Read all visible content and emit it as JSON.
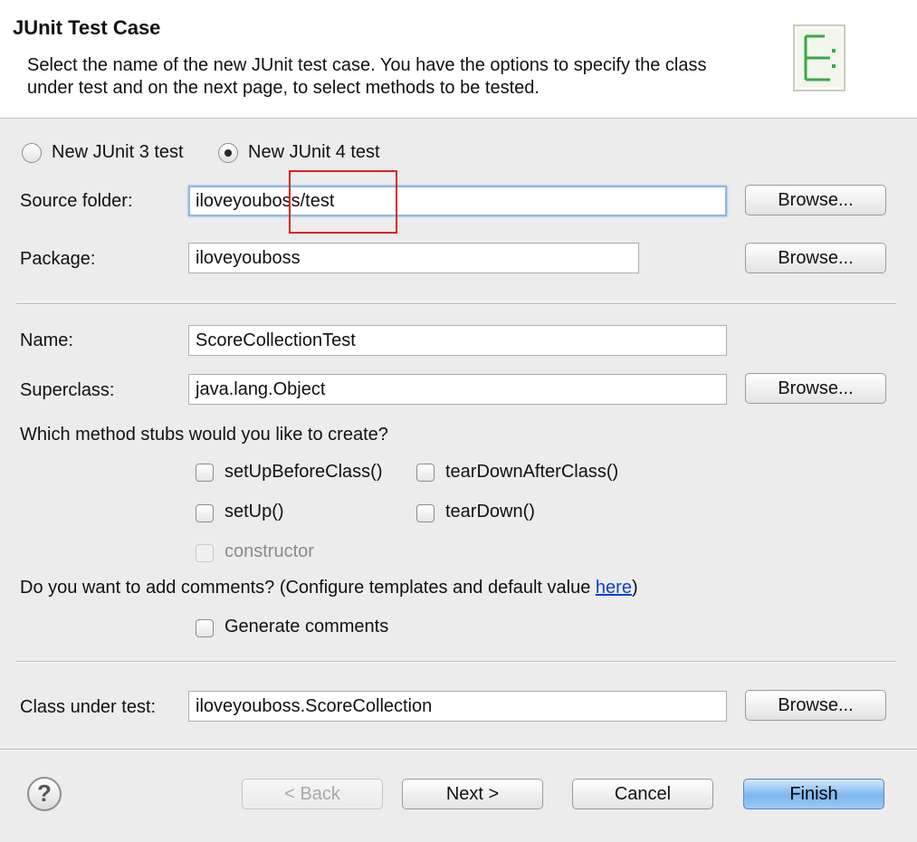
{
  "header": {
    "title": "JUnit Test Case",
    "description": "Select the name of the new JUnit test case. You have the options to specify the class under test and on the next page, to select methods to be tested."
  },
  "version": {
    "junit3_label": "New JUnit 3 test",
    "junit4_label": "New JUnit 4 test",
    "selected": "junit4"
  },
  "source_folder": {
    "label": "Source folder:",
    "value": "iloveyouboss/test"
  },
  "package": {
    "label": "Package:",
    "value": "iloveyouboss"
  },
  "name": {
    "label": "Name:",
    "value": "ScoreCollectionTest"
  },
  "superclass": {
    "label": "Superclass:",
    "value": "java.lang.Object"
  },
  "browse_label": "Browse...",
  "stubs": {
    "question": "Which method stubs would you like to create?",
    "setup_before_class": "setUpBeforeClass()",
    "teardown_after_class": "tearDownAfterClass()",
    "setup": "setUp()",
    "teardown": "tearDown()",
    "constructor": "constructor"
  },
  "comments": {
    "question_prefix": "Do you want to add comments? (Configure templates and default value ",
    "link": "here",
    "question_suffix": ")",
    "generate_label": "Generate comments"
  },
  "class_under_test": {
    "label": "Class under test:",
    "value": "iloveyouboss.ScoreCollection"
  },
  "footer": {
    "help": "?",
    "back": "< Back",
    "next": "Next >",
    "cancel": "Cancel",
    "finish": "Finish"
  }
}
